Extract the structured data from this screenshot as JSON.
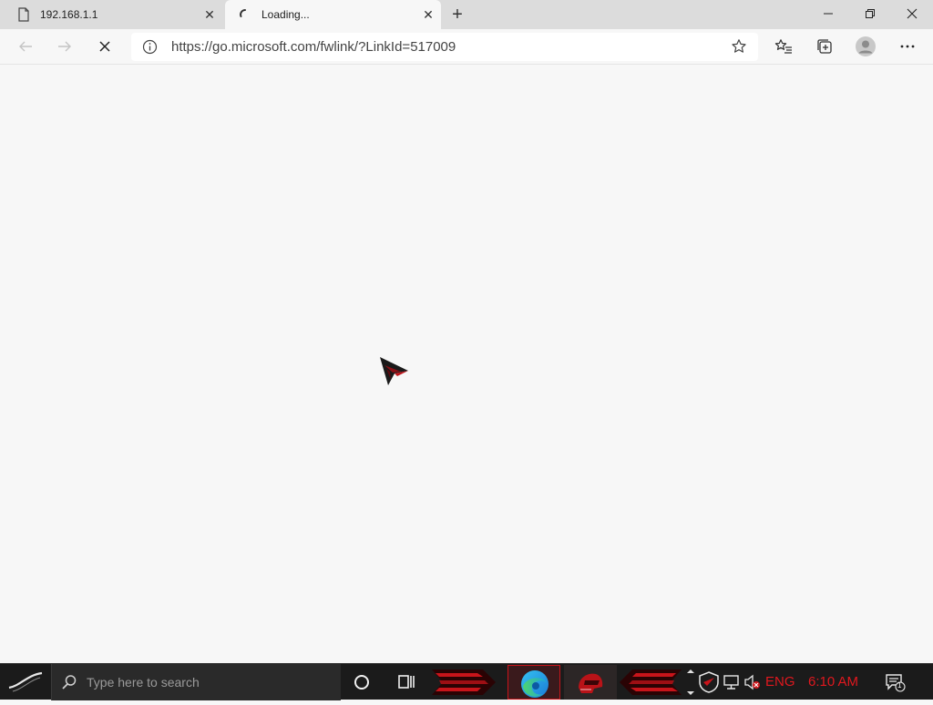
{
  "browser": {
    "tabs": [
      {
        "title": "192.168.1.1",
        "icon": "page-icon",
        "active": false
      },
      {
        "title": "Loading...",
        "icon": "loading-spinner-icon",
        "active": true
      }
    ],
    "address": {
      "url": "https://go.microsoft.com/fwlink/?LinkId=517009"
    }
  },
  "taskbar": {
    "search_placeholder": "Type here to search",
    "language": "ENG",
    "time": "6:10 AM",
    "notification_count": "1"
  },
  "colors": {
    "accent_red": "#e0181e",
    "page_bg": "#f7f7f7",
    "tabstrip_bg": "#dcdcdc",
    "taskbar_bg": "#1b1b1b"
  }
}
